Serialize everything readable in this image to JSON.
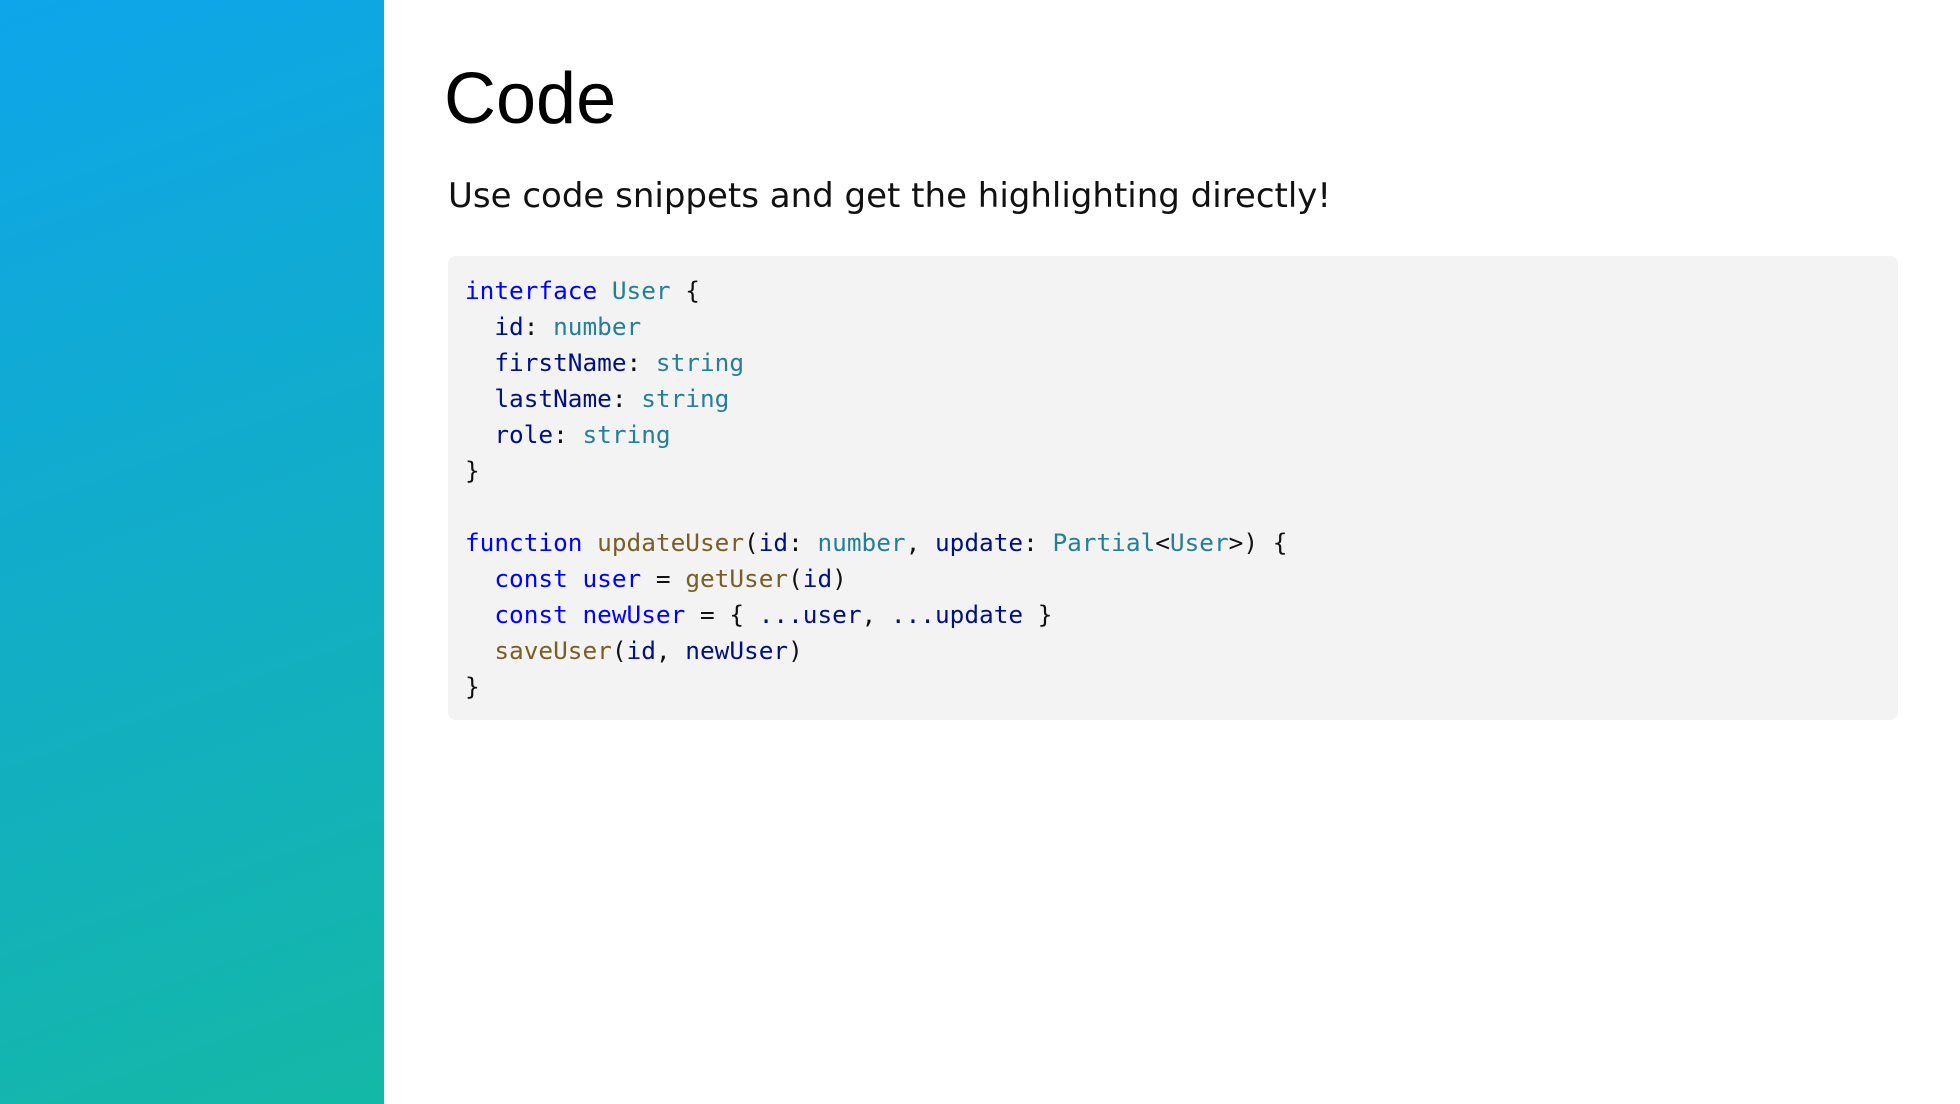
{
  "slide": {
    "title": "Code",
    "subtitle": "Use code snippets and get the highlighting directly!"
  },
  "colors": {
    "keyword": "#0000ff",
    "type": "#267f99",
    "property": "#001080",
    "function": "#795e26",
    "plain": "#111111",
    "code_background": "#f3f3f3",
    "side_gradient_start": "#0ea5ea",
    "side_gradient_end": "#14b8a6"
  },
  "code": {
    "language": "typescript",
    "lines": [
      [
        {
          "t": "interface",
          "c": "keyword"
        },
        {
          "t": " ",
          "c": "plain"
        },
        {
          "t": "User",
          "c": "type"
        },
        {
          "t": " {",
          "c": "plain"
        }
      ],
      [
        {
          "t": "  ",
          "c": "plain"
        },
        {
          "t": "id",
          "c": "prop"
        },
        {
          "t": ": ",
          "c": "plain"
        },
        {
          "t": "number",
          "c": "type"
        }
      ],
      [
        {
          "t": "  ",
          "c": "plain"
        },
        {
          "t": "firstName",
          "c": "prop"
        },
        {
          "t": ": ",
          "c": "plain"
        },
        {
          "t": "string",
          "c": "type"
        }
      ],
      [
        {
          "t": "  ",
          "c": "plain"
        },
        {
          "t": "lastName",
          "c": "prop"
        },
        {
          "t": ": ",
          "c": "plain"
        },
        {
          "t": "string",
          "c": "type"
        }
      ],
      [
        {
          "t": "  ",
          "c": "plain"
        },
        {
          "t": "role",
          "c": "prop"
        },
        {
          "t": ": ",
          "c": "plain"
        },
        {
          "t": "string",
          "c": "type"
        }
      ],
      [
        {
          "t": "}",
          "c": "plain"
        }
      ],
      [],
      [
        {
          "t": "function",
          "c": "keyword"
        },
        {
          "t": " ",
          "c": "plain"
        },
        {
          "t": "updateUser",
          "c": "func"
        },
        {
          "t": "(",
          "c": "plain"
        },
        {
          "t": "id",
          "c": "prop"
        },
        {
          "t": ": ",
          "c": "plain"
        },
        {
          "t": "number",
          "c": "type"
        },
        {
          "t": ", ",
          "c": "plain"
        },
        {
          "t": "update",
          "c": "prop"
        },
        {
          "t": ": ",
          "c": "plain"
        },
        {
          "t": "Partial",
          "c": "type"
        },
        {
          "t": "<",
          "c": "plain"
        },
        {
          "t": "User",
          "c": "type"
        },
        {
          "t": ">) {",
          "c": "plain"
        }
      ],
      [
        {
          "t": "  ",
          "c": "plain"
        },
        {
          "t": "const",
          "c": "keyword"
        },
        {
          "t": " ",
          "c": "plain"
        },
        {
          "t": "user",
          "c": "keyword"
        },
        {
          "t": " = ",
          "c": "plain"
        },
        {
          "t": "getUser",
          "c": "func"
        },
        {
          "t": "(",
          "c": "plain"
        },
        {
          "t": "id",
          "c": "prop"
        },
        {
          "t": ")",
          "c": "plain"
        }
      ],
      [
        {
          "t": "  ",
          "c": "plain"
        },
        {
          "t": "const",
          "c": "keyword"
        },
        {
          "t": " ",
          "c": "plain"
        },
        {
          "t": "newUser",
          "c": "keyword"
        },
        {
          "t": " = { ",
          "c": "plain"
        },
        {
          "t": "...",
          "c": "prop"
        },
        {
          "t": "user",
          "c": "prop"
        },
        {
          "t": ", ",
          "c": "plain"
        },
        {
          "t": "...",
          "c": "prop"
        },
        {
          "t": "update",
          "c": "prop"
        },
        {
          "t": " }",
          "c": "plain"
        }
      ],
      [
        {
          "t": "  ",
          "c": "plain"
        },
        {
          "t": "saveUser",
          "c": "func"
        },
        {
          "t": "(",
          "c": "plain"
        },
        {
          "t": "id",
          "c": "prop"
        },
        {
          "t": ", ",
          "c": "plain"
        },
        {
          "t": "newUser",
          "c": "prop"
        },
        {
          "t": ")",
          "c": "plain"
        }
      ],
      [
        {
          "t": "}",
          "c": "plain"
        }
      ]
    ]
  }
}
